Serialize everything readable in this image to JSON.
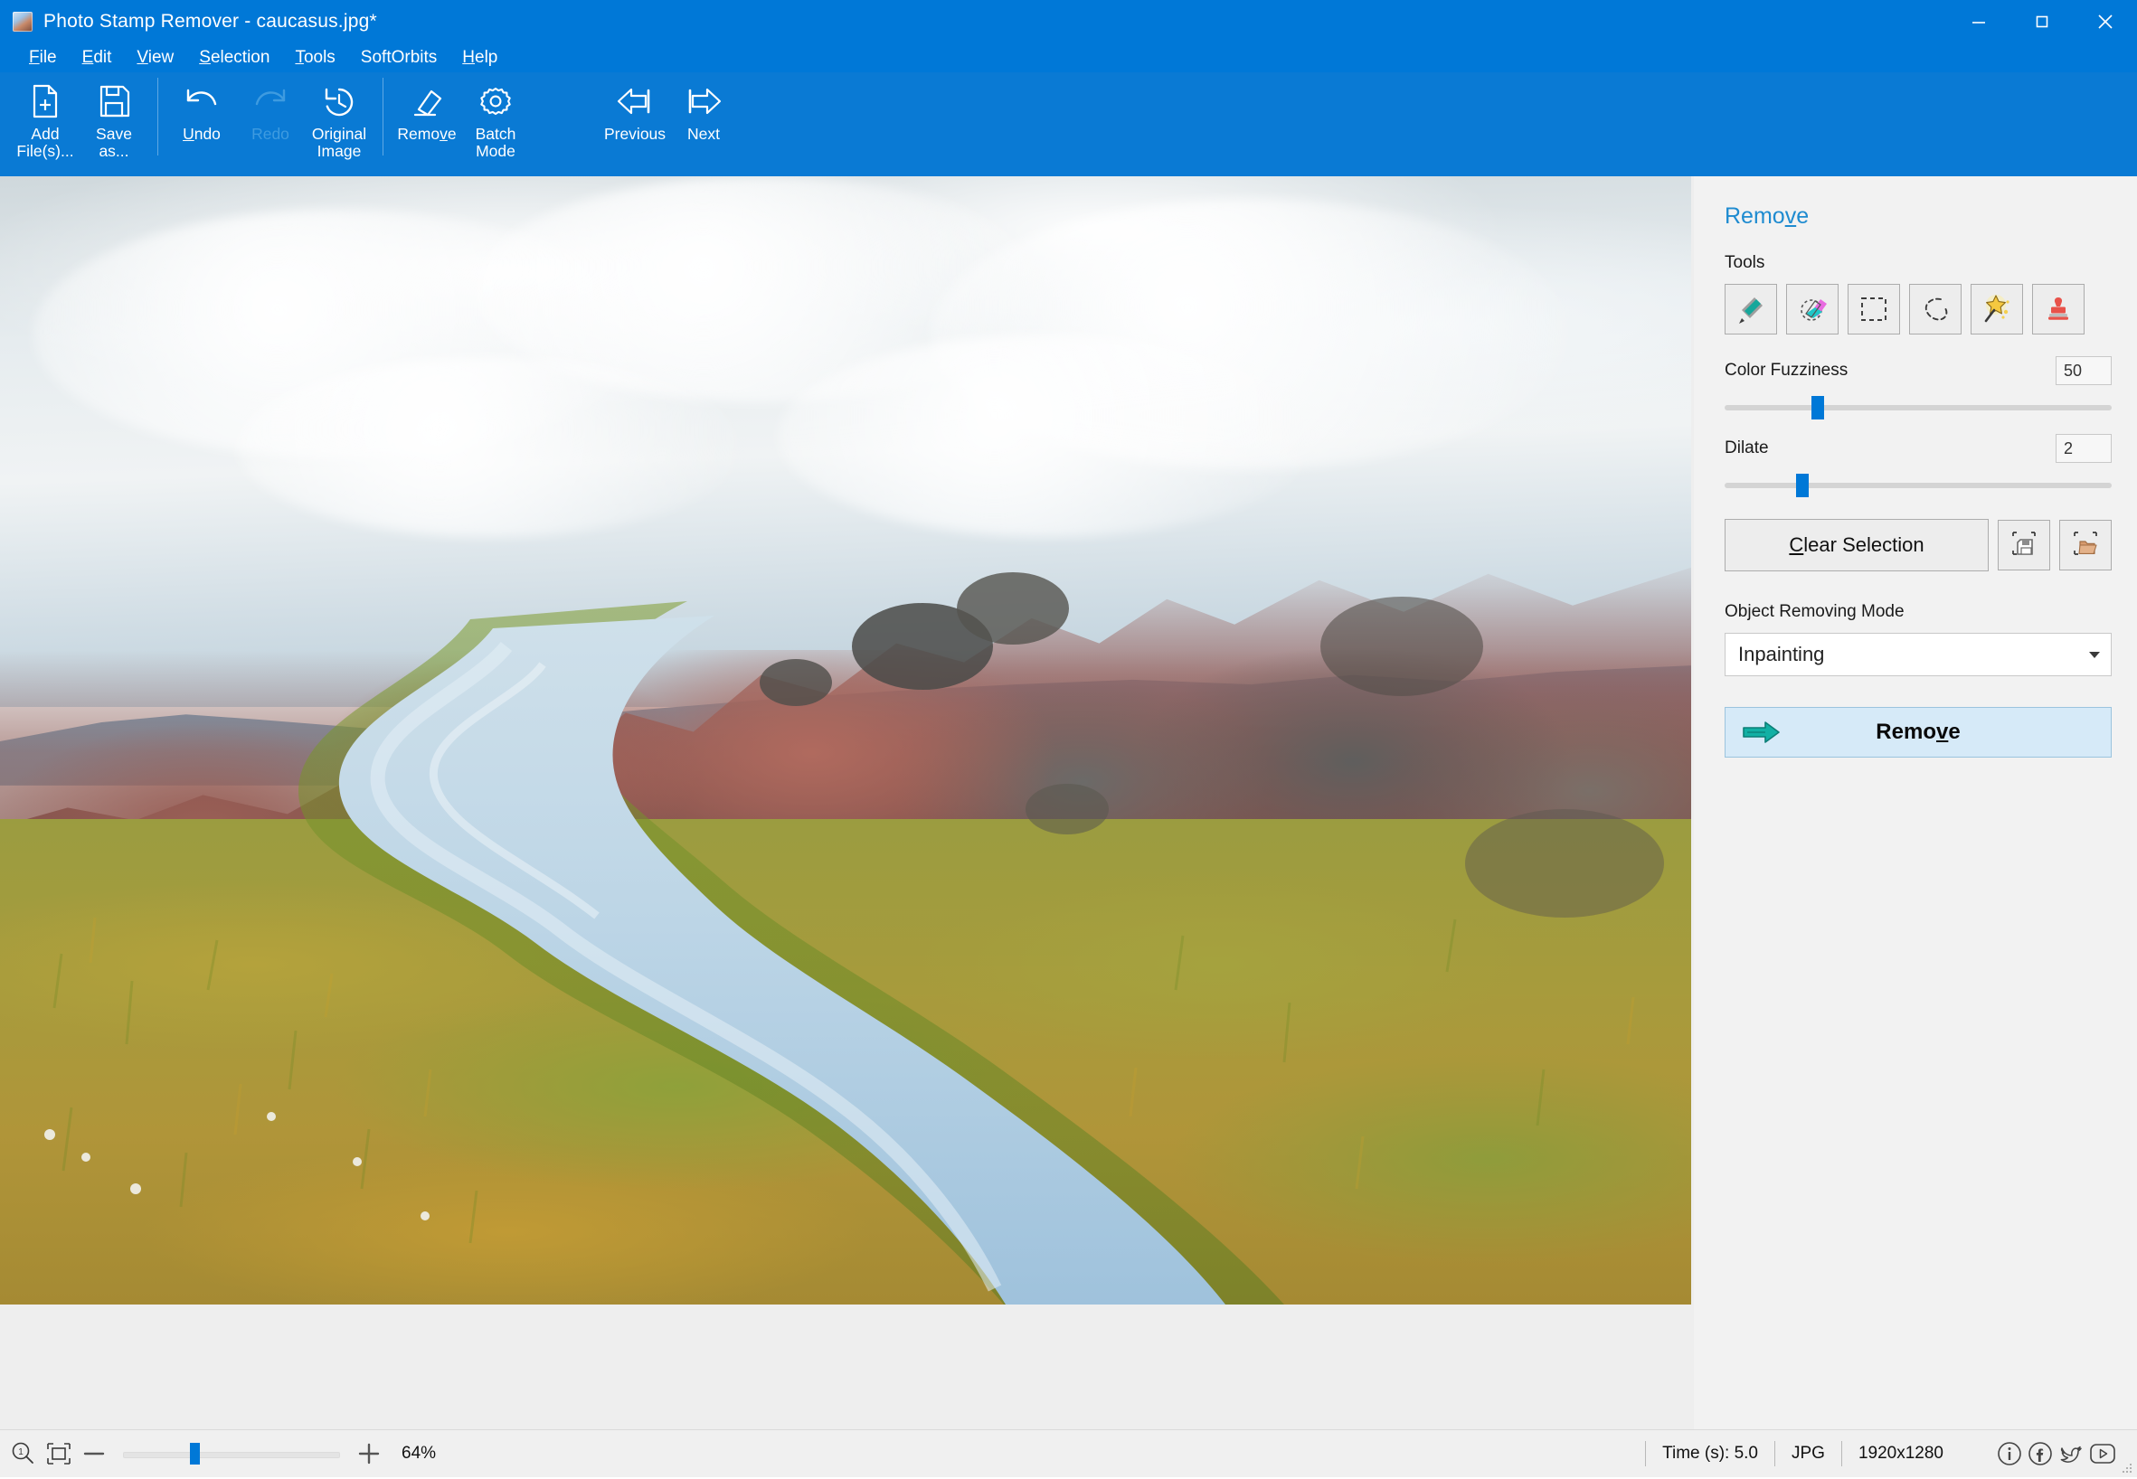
{
  "window": {
    "title": "Photo Stamp Remover - caucasus.jpg*",
    "icon": "app-icon",
    "minimize": "minimize",
    "maximize": "maximize",
    "close": "close"
  },
  "menubar": {
    "items": [
      {
        "label": "File",
        "accel": "F"
      },
      {
        "label": "Edit",
        "accel": "E"
      },
      {
        "label": "View",
        "accel": "V"
      },
      {
        "label": "Selection",
        "accel": "S"
      },
      {
        "label": "Tools",
        "accel": "T"
      },
      {
        "label": "SoftOrbits",
        "accel": ""
      },
      {
        "label": "Help",
        "accel": "H"
      }
    ]
  },
  "toolbar": {
    "add_files": "Add\nFile(s)...",
    "save_as": "Save\nas...",
    "undo": "Undo",
    "redo": "Redo",
    "original_image": "Original\nImage",
    "remove": "Remove",
    "batch_mode": "Batch\nMode",
    "previous": "Previous",
    "next": "Next"
  },
  "panel": {
    "title": "Remove",
    "tools_label": "Tools",
    "tools": [
      {
        "name": "marker-tool",
        "icon": "marker-icon"
      },
      {
        "name": "eraser-tool",
        "icon": "eraser-icon"
      },
      {
        "name": "rectangle-select-tool",
        "icon": "rectangle-select-icon"
      },
      {
        "name": "lasso-select-tool",
        "icon": "lasso-icon"
      },
      {
        "name": "magic-wand-tool",
        "icon": "magic-wand-icon"
      },
      {
        "name": "clone-stamp-tool",
        "icon": "stamp-icon"
      }
    ],
    "color_fuzziness": {
      "label": "Color Fuzziness",
      "value": "50",
      "percent": 24
    },
    "dilate": {
      "label": "Dilate",
      "value": "2",
      "percent": 20
    },
    "clear_selection": "Clear Selection",
    "save_selection_icon": "save-selection-icon",
    "load_selection_icon": "load-selection-icon",
    "object_removing_mode_label": "Object Removing Mode",
    "object_removing_mode_value": "Inpainting",
    "remove_button": "Remove"
  },
  "statusbar": {
    "zoom_100_icon": "zoom-100-icon",
    "fit_icon": "fit-to-window-icon",
    "zoom_out_icon": "zoom-out-icon",
    "zoom_in_icon": "zoom-in-icon",
    "zoom_percent": "64%",
    "zoom_slider_percent": 33,
    "time": "Time (s): 5.0",
    "format": "JPG",
    "dimensions": "1920x1280",
    "social": [
      {
        "name": "info-icon"
      },
      {
        "name": "facebook-icon"
      },
      {
        "name": "twitter-icon"
      },
      {
        "name": "youtube-icon"
      }
    ]
  },
  "colors": {
    "accent_blue": "#0078D7",
    "toolbar_blue": "#0A7AD4",
    "panel_title_blue": "#1E8BD0",
    "remove_button_bg": "#D6EAF8",
    "remove_arrow_teal": "#0FA89B",
    "panel_bg": "#F2F2F2"
  },
  "image": {
    "name": "caucasus-landscape-photo",
    "description": "Mountain stream winding through golden-green alpine meadow with red volcanic rocks and clouds"
  }
}
